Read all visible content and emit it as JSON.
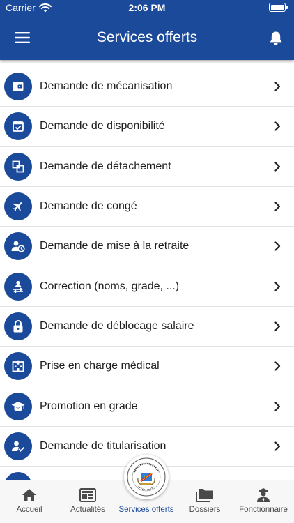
{
  "status_bar": {
    "carrier": "Carrier",
    "time": "2:06 PM"
  },
  "header": {
    "title": "Services offerts",
    "menu_icon": "hamburger-icon",
    "bell_icon": "bell-icon"
  },
  "colors": {
    "primary": "#1b4a9b",
    "divider": "#e3e3e3",
    "tab_bg": "#f7f7f7",
    "tab_inactive": "#4a4a4a"
  },
  "services": [
    {
      "label": "Demande de mécanisation",
      "icon": "wallet-icon"
    },
    {
      "label": "Demande de disponibilité",
      "icon": "calendar-check-icon"
    },
    {
      "label": "Demande de détachement",
      "icon": "transfer-icon"
    },
    {
      "label": "Demande de congé",
      "icon": "airplane-icon"
    },
    {
      "label": "Demande de mise à la retraite",
      "icon": "person-clock-icon"
    },
    {
      "label": "Correction (noms, grade, ...)",
      "icon": "people-swap-icon"
    },
    {
      "label": "Demande de déblocage salaire",
      "icon": "lock-icon"
    },
    {
      "label": "Prise en charge médical",
      "icon": "hospital-icon"
    },
    {
      "label": "Promotion en grade",
      "icon": "graduation-cap-icon"
    },
    {
      "label": "Demande de titularisation",
      "icon": "person-check-icon"
    }
  ],
  "tabs": [
    {
      "label": "Accueil",
      "icon": "home-icon"
    },
    {
      "label": "Actualités",
      "icon": "newspaper-icon"
    },
    {
      "label": "Services offerts",
      "icon": "government-seal-icon",
      "active": true
    },
    {
      "label": "Dossiers",
      "icon": "folders-icon"
    },
    {
      "label": "Fonctionnaire",
      "icon": "officer-icon"
    }
  ]
}
